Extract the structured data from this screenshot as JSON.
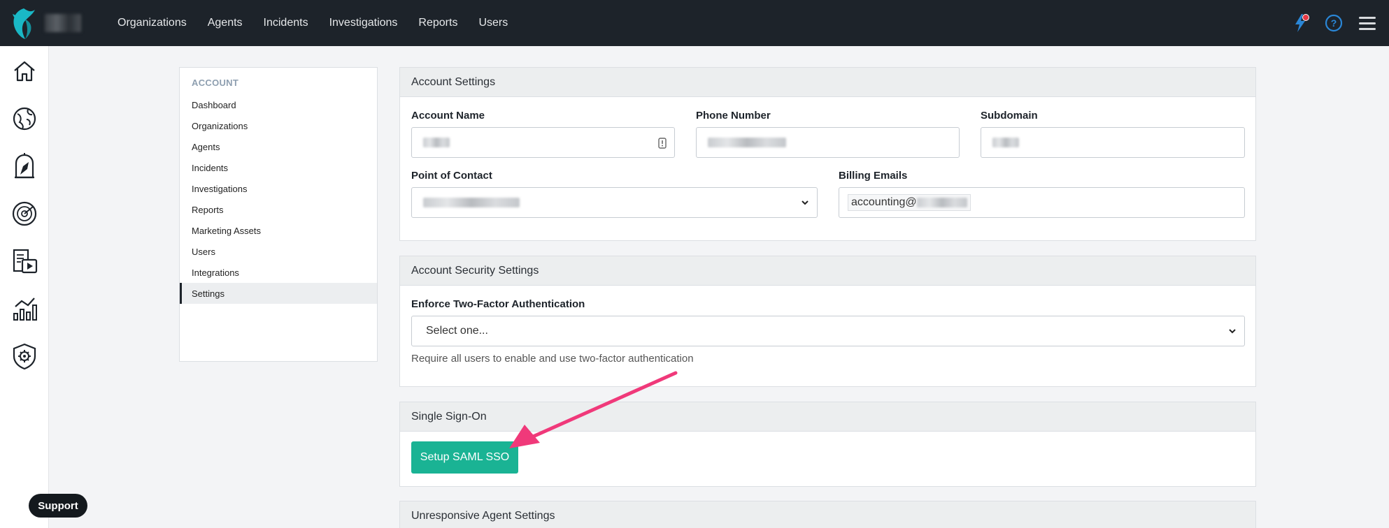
{
  "topnav": {
    "items": [
      "Organizations",
      "Agents",
      "Incidents",
      "Investigations",
      "Reports",
      "Users"
    ]
  },
  "icons": {
    "logo": "brand-logo-icon",
    "notifications": "lightning-icon",
    "help": "help-circle-icon",
    "menu": "hamburger-menu-icon",
    "rail": [
      "home-icon",
      "globe-icon",
      "bird-cage-icon",
      "radar-icon",
      "document-video-icon",
      "chart-icon",
      "shield-gear-icon"
    ]
  },
  "colors": {
    "accent": "#1ab394",
    "nav_bg": "#1d232a",
    "logo": "#1ab8c6",
    "annotation_arrow": "#f0397a"
  },
  "sidebar": {
    "heading": "ACCOUNT",
    "items": [
      "Dashboard",
      "Organizations",
      "Agents",
      "Incidents",
      "Investigations",
      "Reports",
      "Marketing Assets",
      "Users",
      "Integrations",
      "Settings"
    ],
    "active": "Settings"
  },
  "account_settings": {
    "title": "Account Settings",
    "account_name_label": "Account Name",
    "phone_label": "Phone Number",
    "subdomain_label": "Subdomain",
    "poc_label": "Point of Contact",
    "billing_label": "Billing Emails",
    "billing_value": "accounting@"
  },
  "security": {
    "title": "Account Security Settings",
    "twofa_label": "Enforce Two-Factor Authentication",
    "twofa_value": "Select one...",
    "twofa_help": "Require all users to enable and use two-factor authentication"
  },
  "sso": {
    "title": "Single Sign-On",
    "button": "Setup SAML SSO"
  },
  "unresponsive": {
    "title": "Unresponsive Agent Settings"
  },
  "support": {
    "label": "Support"
  }
}
